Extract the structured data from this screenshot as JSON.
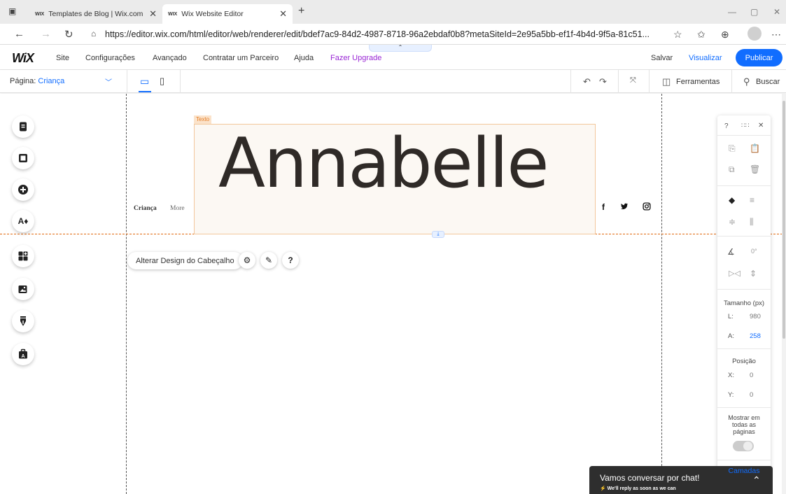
{
  "browser": {
    "tabs": [
      {
        "favicon": "wix",
        "title": "Templates de Blog | Wix.com",
        "active": false
      },
      {
        "favicon": "wix",
        "title": "Wix Website Editor",
        "active": true
      }
    ],
    "url": "https://editor.wix.com/html/editor/web/renderer/edit/bdef7ac9-84d2-4987-8718-96a2ebdaf0b8?metaSiteId=2e95a5bb-ef1f-4b4d-9f5a-81c51...",
    "icons": [
      "sidebar-icon",
      "back-icon",
      "forward-icon",
      "reload-icon",
      "lock-icon",
      "read-aloud-icon",
      "favorites-icon",
      "collections-icon",
      "profile-avatar",
      "more-icon",
      "minimize-icon",
      "restore-icon",
      "close-icon",
      "new-tab-icon",
      "tab-close-icon"
    ]
  },
  "wix": {
    "logo": "WiX",
    "menu": [
      "Site",
      "Configurações",
      "Avançado",
      "Contratar um Parceiro",
      "Ajuda"
    ],
    "upgrade": "Fazer Upgrade",
    "save": "Salvar",
    "preview": "Visualizar",
    "publish": "Publicar",
    "accent_color": "#116dff",
    "upgrade_color": "#9a27d5"
  },
  "toolbar": {
    "page_label": "Página:",
    "page_name": "Criança",
    "tools": "Ferramentas",
    "search": "Buscar"
  },
  "canvas": {
    "textbox_tag": "Texto",
    "title": "Annabelle",
    "nav": [
      "Criança",
      "More"
    ],
    "social": [
      "f",
      "twitter",
      "instagram"
    ],
    "change_design": "Alterar Design do Cabeçalho"
  },
  "right_panel": {
    "help": "?",
    "size_label": "Tamanho (px)",
    "width_key": "L:",
    "width_value": "980",
    "height_key": "A:",
    "height_value": "258",
    "position_label": "Posição",
    "x_key": "X:",
    "x_value": "0",
    "y_key": "Y:",
    "y_value": "0",
    "rotation_value": "0°",
    "show_all_pages": "Mostrar em todas as páginas",
    "layers": "Camadas"
  },
  "chat": {
    "title": "Vamos conversar por chat!",
    "subtitle": "We'll reply as soon as we can"
  }
}
